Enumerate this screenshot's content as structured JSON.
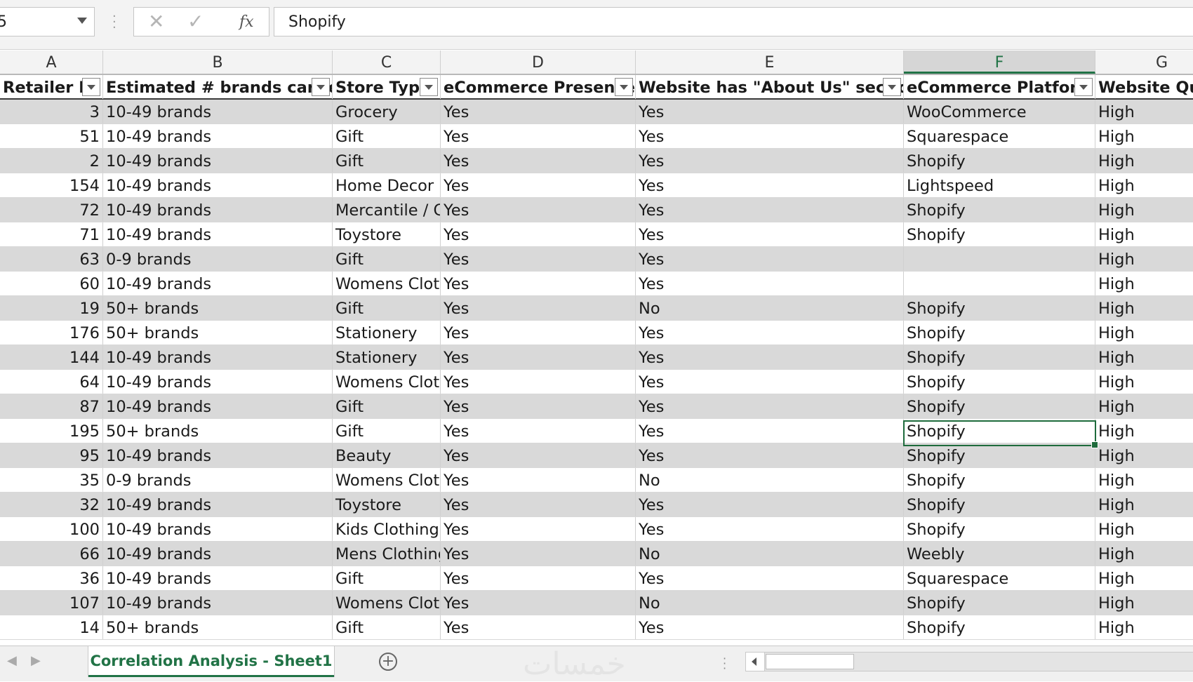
{
  "formula_bar": {
    "name_box": "5",
    "cancel_icon": "✕",
    "enter_icon": "✓",
    "function_icon": "fx",
    "formula": "Shopify"
  },
  "columns": [
    {
      "letter": "A"
    },
    {
      "letter": "B"
    },
    {
      "letter": "C"
    },
    {
      "letter": "D"
    },
    {
      "letter": "E"
    },
    {
      "letter": "F",
      "active": true
    },
    {
      "letter": "G"
    }
  ],
  "table": {
    "headers": [
      "Retailer ID",
      "Estimated # brands carried",
      "Store Type",
      "eCommerce Presence",
      "Website has \"About Us\" section",
      "eCommerce Platform",
      "Website Qua"
    ],
    "rows": [
      [
        "3",
        "10-49 brands",
        "Grocery",
        "Yes",
        "Yes",
        "WooCommerce",
        "High"
      ],
      [
        "51",
        "10-49 brands",
        "Gift",
        "Yes",
        "Yes",
        "Squarespace",
        "High"
      ],
      [
        "2",
        "10-49 brands",
        "Gift",
        "Yes",
        "Yes",
        "Shopify",
        "High"
      ],
      [
        "154",
        "10-49 brands",
        "Home Decor",
        "Yes",
        "Yes",
        "Lightspeed",
        "High"
      ],
      [
        "72",
        "10-49 brands",
        "Mercantile / G",
        "Yes",
        "Yes",
        "Shopify",
        "High"
      ],
      [
        "71",
        "10-49 brands",
        "Toystore",
        "Yes",
        "Yes",
        "Shopify",
        "High"
      ],
      [
        "63",
        "0-9 brands",
        "Gift",
        "Yes",
        "Yes",
        "",
        "High"
      ],
      [
        "60",
        "10-49 brands",
        "Womens Clot",
        "Yes",
        "Yes",
        "",
        "High"
      ],
      [
        "19",
        "50+ brands",
        "Gift",
        "Yes",
        "No",
        "Shopify",
        "High"
      ],
      [
        "176",
        "50+ brands",
        "Stationery",
        "Yes",
        "Yes",
        "Shopify",
        "High"
      ],
      [
        "144",
        "10-49 brands",
        "Stationery",
        "Yes",
        "Yes",
        "Shopify",
        "High"
      ],
      [
        "64",
        "10-49 brands",
        "Womens Clot",
        "Yes",
        "Yes",
        "Shopify",
        "High"
      ],
      [
        "87",
        "10-49 brands",
        "Gift",
        "Yes",
        "Yes",
        "Shopify",
        "High"
      ],
      [
        "195",
        "50+ brands",
        "Gift",
        "Yes",
        "Yes",
        "Shopify",
        "High"
      ],
      [
        "95",
        "10-49 brands",
        "Beauty",
        "Yes",
        "Yes",
        "Shopify",
        "High"
      ],
      [
        "35",
        "0-9 brands",
        "Womens Clot",
        "Yes",
        "No",
        "Shopify",
        "High"
      ],
      [
        "32",
        "10-49 brands",
        "Toystore",
        "Yes",
        "Yes",
        "Shopify",
        "High"
      ],
      [
        "100",
        "10-49 brands",
        "Kids Clothing",
        "Yes",
        "Yes",
        "Shopify",
        "High"
      ],
      [
        "66",
        "10-49 brands",
        "Mens Clothing",
        "Yes",
        "No",
        "Weebly",
        "High"
      ],
      [
        "36",
        "10-49 brands",
        "Gift",
        "Yes",
        "Yes",
        "Squarespace",
        "High"
      ],
      [
        "107",
        "10-49 brands",
        "Womens Clot",
        "Yes",
        "No",
        "Shopify",
        "High"
      ],
      [
        "14",
        "50+ brands",
        "Gift",
        "Yes",
        "Yes",
        "Shopify",
        "High"
      ]
    ]
  },
  "sheet_tabs": {
    "prev_icon": "◀",
    "next_icon": "▶",
    "active_tab": "Correlation Analysis - Sheet1",
    "add_sheet_icon": "+",
    "watermark": "خمسات"
  },
  "colors": {
    "accent": "#217346",
    "band_row": "#d9d9d9",
    "selection": "#1e6b3c"
  }
}
